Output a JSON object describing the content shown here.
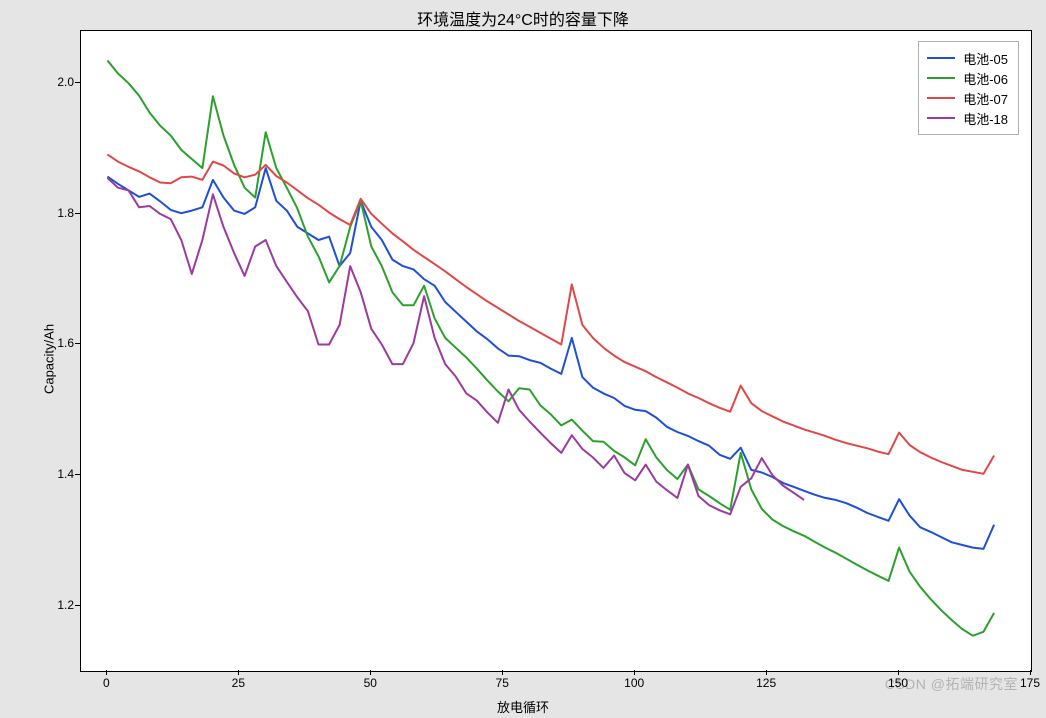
{
  "chart_data": {
    "type": "line",
    "title": "环境温度为24°C时的容量下降",
    "xlabel": "放电循环",
    "ylabel": "Capacity/Ah",
    "xlim": [
      -5,
      175
    ],
    "ylim": [
      1.1,
      2.08
    ],
    "x_ticks": [
      0,
      25,
      50,
      75,
      100,
      125,
      150,
      175
    ],
    "y_ticks": [
      1.2,
      1.4,
      1.6,
      1.8,
      2.0
    ],
    "legend_position": "upper right",
    "series": [
      {
        "name": "电池-05",
        "color": "#1f4fd6",
        "x": [
          0,
          2,
          4,
          6,
          8,
          10,
          12,
          14,
          16,
          18,
          20,
          22,
          24,
          26,
          28,
          30,
          32,
          34,
          36,
          38,
          40,
          42,
          44,
          46,
          48,
          50,
          52,
          54,
          56,
          58,
          60,
          62,
          64,
          66,
          68,
          70,
          72,
          74,
          76,
          78,
          80,
          82,
          84,
          86,
          88,
          90,
          92,
          94,
          96,
          98,
          100,
          102,
          104,
          106,
          108,
          110,
          112,
          114,
          116,
          118,
          120,
          122,
          124,
          126,
          128,
          130,
          132,
          134,
          136,
          138,
          140,
          142,
          144,
          146,
          148,
          150,
          152,
          154,
          156,
          158,
          160,
          162,
          164,
          166,
          168
        ],
        "y": [
          1.857,
          1.846,
          1.836,
          1.826,
          1.831,
          1.819,
          1.806,
          1.801,
          1.805,
          1.81,
          1.852,
          1.825,
          1.805,
          1.8,
          1.81,
          1.87,
          1.82,
          1.805,
          1.78,
          1.77,
          1.76,
          1.765,
          1.72,
          1.74,
          1.82,
          1.78,
          1.76,
          1.73,
          1.72,
          1.715,
          1.7,
          1.69,
          1.665,
          1.65,
          1.635,
          1.62,
          1.608,
          1.594,
          1.583,
          1.582,
          1.576,
          1.572,
          1.563,
          1.555,
          1.61,
          1.55,
          1.534,
          1.525,
          1.518,
          1.506,
          1.5,
          1.498,
          1.488,
          1.474,
          1.466,
          1.46,
          1.452,
          1.445,
          1.431,
          1.425,
          1.442,
          1.408,
          1.404,
          1.397,
          1.388,
          1.382,
          1.376,
          1.37,
          1.365,
          1.362,
          1.357,
          1.35,
          1.342,
          1.336,
          1.33,
          1.363,
          1.338,
          1.32,
          1.313,
          1.305,
          1.297,
          1.293,
          1.289,
          1.287,
          1.324
        ]
      },
      {
        "name": "电池-06",
        "color": "#2ca02c",
        "x": [
          0,
          2,
          4,
          6,
          8,
          10,
          12,
          14,
          16,
          18,
          20,
          22,
          24,
          26,
          28,
          30,
          32,
          34,
          36,
          38,
          40,
          42,
          44,
          46,
          48,
          50,
          52,
          54,
          56,
          58,
          60,
          62,
          64,
          66,
          68,
          70,
          72,
          74,
          76,
          78,
          80,
          82,
          84,
          86,
          88,
          90,
          92,
          94,
          96,
          98,
          100,
          102,
          104,
          106,
          108,
          110,
          112,
          114,
          116,
          118,
          120,
          122,
          124,
          126,
          128,
          130,
          132,
          134,
          136,
          138,
          140,
          142,
          144,
          146,
          148,
          150,
          152,
          154,
          156,
          158,
          160,
          162,
          164,
          166,
          168
        ],
        "y": [
          2.035,
          2.015,
          2.0,
          1.981,
          1.955,
          1.935,
          1.92,
          1.898,
          1.884,
          1.87,
          1.98,
          1.92,
          1.875,
          1.84,
          1.825,
          1.925,
          1.87,
          1.84,
          1.808,
          1.765,
          1.735,
          1.695,
          1.72,
          1.78,
          1.82,
          1.75,
          1.72,
          1.68,
          1.66,
          1.66,
          1.69,
          1.64,
          1.61,
          1.595,
          1.58,
          1.563,
          1.545,
          1.528,
          1.513,
          1.533,
          1.531,
          1.507,
          1.493,
          1.476,
          1.485,
          1.468,
          1.452,
          1.451,
          1.437,
          1.427,
          1.415,
          1.455,
          1.427,
          1.408,
          1.394,
          1.416,
          1.378,
          1.368,
          1.357,
          1.347,
          1.434,
          1.378,
          1.348,
          1.332,
          1.322,
          1.314,
          1.307,
          1.298,
          1.289,
          1.281,
          1.272,
          1.263,
          1.254,
          1.246,
          1.238,
          1.289,
          1.252,
          1.229,
          1.21,
          1.193,
          1.178,
          1.164,
          1.154,
          1.16,
          1.189
        ]
      },
      {
        "name": "电池-07",
        "color": "#e04848",
        "x": [
          0,
          2,
          4,
          6,
          8,
          10,
          12,
          14,
          16,
          18,
          20,
          22,
          24,
          26,
          28,
          30,
          32,
          34,
          36,
          38,
          40,
          42,
          44,
          46,
          48,
          50,
          52,
          54,
          56,
          58,
          60,
          62,
          64,
          66,
          68,
          70,
          72,
          74,
          76,
          78,
          80,
          82,
          84,
          86,
          88,
          90,
          92,
          94,
          96,
          98,
          100,
          102,
          104,
          106,
          108,
          110,
          112,
          114,
          116,
          118,
          120,
          122,
          124,
          126,
          128,
          130,
          132,
          134,
          136,
          138,
          140,
          142,
          144,
          146,
          148,
          150,
          152,
          154,
          156,
          158,
          160,
          162,
          164,
          166,
          168
        ],
        "y": [
          1.891,
          1.88,
          1.872,
          1.865,
          1.856,
          1.848,
          1.847,
          1.856,
          1.857,
          1.852,
          1.88,
          1.874,
          1.862,
          1.856,
          1.86,
          1.875,
          1.858,
          1.848,
          1.836,
          1.824,
          1.814,
          1.802,
          1.792,
          1.783,
          1.823,
          1.8,
          1.785,
          1.77,
          1.758,
          1.745,
          1.734,
          1.723,
          1.712,
          1.7,
          1.688,
          1.677,
          1.666,
          1.656,
          1.646,
          1.636,
          1.627,
          1.618,
          1.609,
          1.6,
          1.692,
          1.63,
          1.61,
          1.595,
          1.583,
          1.573,
          1.566,
          1.559,
          1.55,
          1.542,
          1.534,
          1.525,
          1.518,
          1.51,
          1.503,
          1.497,
          1.537,
          1.51,
          1.498,
          1.49,
          1.482,
          1.476,
          1.47,
          1.465,
          1.46,
          1.454,
          1.449,
          1.445,
          1.441,
          1.436,
          1.432,
          1.465,
          1.446,
          1.435,
          1.427,
          1.42,
          1.414,
          1.408,
          1.405,
          1.402,
          1.43
        ]
      },
      {
        "name": "电池-18",
        "color": "#9c3aa0",
        "x": [
          0,
          2,
          4,
          6,
          8,
          10,
          12,
          14,
          16,
          18,
          20,
          22,
          24,
          26,
          28,
          30,
          32,
          34,
          36,
          38,
          40,
          42,
          44,
          46,
          48,
          50,
          52,
          54,
          56,
          58,
          60,
          62,
          64,
          66,
          68,
          70,
          72,
          74,
          76,
          78,
          80,
          82,
          84,
          86,
          88,
          90,
          92,
          94,
          96,
          98,
          100,
          102,
          104,
          106,
          108,
          110,
          112,
          114,
          116,
          118,
          120,
          122,
          124,
          126,
          128,
          130,
          132
        ],
        "y": [
          1.855,
          1.84,
          1.836,
          1.81,
          1.812,
          1.8,
          1.792,
          1.76,
          1.708,
          1.76,
          1.83,
          1.78,
          1.74,
          1.705,
          1.75,
          1.76,
          1.72,
          1.696,
          1.672,
          1.651,
          1.6,
          1.6,
          1.63,
          1.72,
          1.68,
          1.624,
          1.6,
          1.57,
          1.57,
          1.602,
          1.674,
          1.61,
          1.57,
          1.551,
          1.525,
          1.514,
          1.496,
          1.48,
          1.531,
          1.5,
          1.482,
          1.465,
          1.449,
          1.434,
          1.461,
          1.44,
          1.427,
          1.411,
          1.43,
          1.403,
          1.392,
          1.416,
          1.39,
          1.377,
          1.365,
          1.416,
          1.368,
          1.354,
          1.346,
          1.34,
          1.382,
          1.395,
          1.426,
          1.4,
          1.384,
          1.373,
          1.362
        ]
      }
    ]
  },
  "watermark": "CSDN @拓端研究室"
}
